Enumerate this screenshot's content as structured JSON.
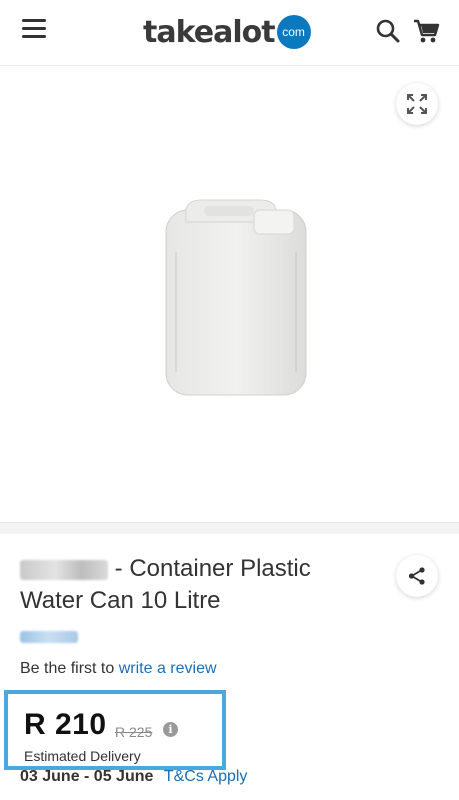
{
  "header": {
    "logo_text": "takealot",
    "logo_badge": "com",
    "icons": [
      "hamburger-menu-icon",
      "search-icon",
      "cart-icon"
    ]
  },
  "gallery": {
    "expand_icon": "expand-icon",
    "image_alt": "white plastic jerry can"
  },
  "product": {
    "title": "- Container Plastic Water Can 10 Litre",
    "share_icon": "share-icon"
  },
  "review": {
    "prefix": "Be the first to",
    "link": "write a review"
  },
  "price": {
    "current": "R 210",
    "previous": "R 225",
    "info_glyph": "i",
    "estimated_label": "Estimated Delivery"
  },
  "delivery": {
    "dates": "03 June - 05 June",
    "terms_link": "T&Cs Apply"
  },
  "colors": {
    "brand_blue": "#0b79bf",
    "link_blue": "#1b6fb5",
    "highlight_border": "#4aa8dd"
  }
}
